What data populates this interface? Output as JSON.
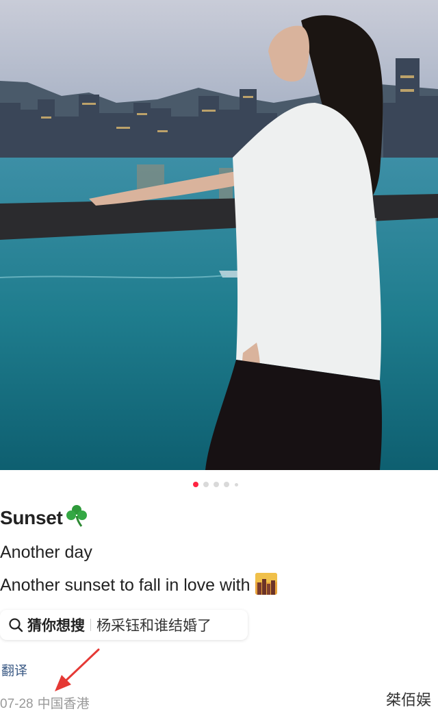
{
  "post": {
    "title": "Sunset",
    "title_emoji": "shamrock-icon",
    "body_line1": "Another day",
    "body_line2": "Another sunset to fall in love with",
    "body_emoji": "city-sunset-icon"
  },
  "carousel": {
    "pages": 5,
    "current": 1
  },
  "search_suggestion": {
    "icon": "search-icon",
    "keyword": "猜你想搜",
    "suggestion": "杨采钰和谁结婚了"
  },
  "translate_label": "翻译",
  "meta": {
    "date": "07-28",
    "location": "中国香港"
  },
  "watermark": "桀佰娱",
  "colors": {
    "active_dot": "#ff2442",
    "link": "#3b5a85",
    "meta": "#999999",
    "annotation_arrow": "#e53935"
  }
}
